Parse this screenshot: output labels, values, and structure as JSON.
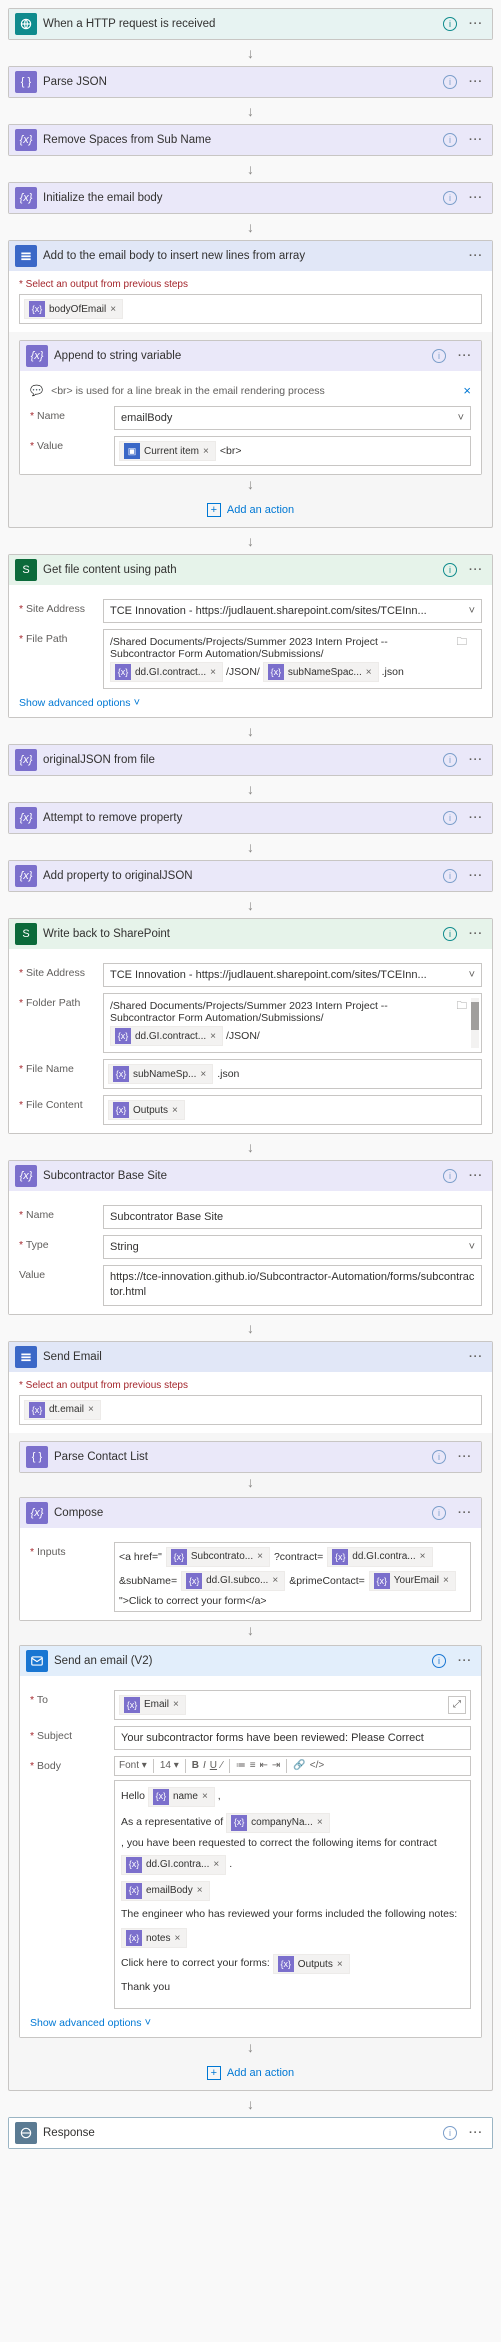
{
  "steps": {
    "trigger": {
      "title": "When a HTTP request is received"
    },
    "parseJson": {
      "title": "Parse JSON"
    },
    "removeSpaces": {
      "title": "Remove Spaces from Sub Name"
    },
    "initBody": {
      "title": "Initialize the email body"
    },
    "loop": {
      "title": "Add to the email body to insert new lines from array",
      "selectHint": "* Select an output from previous steps",
      "outputToken": "bodyOfEmail",
      "append": {
        "title": "Append to string variable",
        "note": "<br> is used for a line break in the email rendering process",
        "nameLabel": "Name",
        "nameValue": "emailBody",
        "valueLabel": "Value",
        "valueToken": "Current item",
        "valueSuffix": "<br>"
      },
      "addAction": "Add an action"
    },
    "getFile": {
      "title": "Get file content using path",
      "siteLabel": "Site Address",
      "siteValue": "TCE Innovation - https://judlauent.sharepoint.com/sites/TCEInn...",
      "pathLabel": "File Path",
      "pathPrefix1": "/Shared Documents/Projects/Summer 2023 Intern Project -- ",
      "pathPrefix2": "Subcontractor Form Automation/Submissions/",
      "token1": "dd.GI.contract...",
      "mid1": "/JSON/",
      "token2": "subNameSpac...",
      "suffix": ".json",
      "advanced": "Show advanced options"
    },
    "origJson": {
      "title": "originalJSON from file"
    },
    "removeProp": {
      "title": "Attempt to remove property"
    },
    "addProp": {
      "title": "Add property to originalJSON"
    },
    "writeBack": {
      "title": "Write back to SharePoint",
      "siteLabel": "Site Address",
      "siteValue": "TCE Innovation - https://judlauent.sharepoint.com/sites/TCEInn...",
      "folderLabel": "Folder Path",
      "folderPrefix1": "/Shared Documents/Projects/Summer 2023 Intern Project -- ",
      "folderPrefix2": "Subcontractor Form Automation/Submissions/",
      "folderToken": "dd.GI.contract...",
      "folderSuffix": "/JSON/",
      "fileNameLabel": "File Name",
      "fileNameToken": "subNameSp...",
      "fileNameSuffix": ".json",
      "fileContentLabel": "File Content",
      "fileContentToken": "Outputs"
    },
    "baseSite": {
      "title": "Subcontractor Base Site",
      "nameLabel": "Name",
      "nameValue": "Subcontrator Base Site",
      "typeLabel": "Type",
      "typeValue": "String",
      "valueLabel": "Value",
      "valueValue": "https://tce-innovation.github.io/Subcontractor-Automation/forms/subcontractor.html"
    },
    "sendEmailOuter": {
      "title": "Send Email",
      "selectHint": "* Select an output from previous steps",
      "outputToken": "dt.email",
      "parseContact": {
        "title": "Parse Contact List"
      },
      "compose": {
        "title": "Compose",
        "inputsLabel": "Inputs",
        "t1": "<a href=\"",
        "token1": "Subcontrato...",
        "t2": "?contract=",
        "token2": "dd.GI.contra...",
        "t3": "&subName=",
        "token3": "dd.GI.subco...",
        "t4": "&primeContact=",
        "token4": "YourEmail",
        "t5": "\">Click to correct your form</a>"
      },
      "email": {
        "title": "Send an email (V2)",
        "toLabel": "To",
        "toToken": "Email",
        "subjectLabel": "Subject",
        "subjectValue": "Your subcontractor forms have been reviewed: Please Correct",
        "bodyLabel": "Body",
        "fontLabel": "Font",
        "sizeValue": "14",
        "l1a": "Hello",
        "l1tok": "name",
        "l1b": ",",
        "l2a": "As a representative of",
        "l2tok1": "companyNa...",
        "l2b": ", you have been requested to correct the following items for contract",
        "l2tok2": "dd.GI.contra...",
        "l2c": ".",
        "l3tok": "emailBody",
        "l4": "The engineer who has reviewed your forms included the following notes:",
        "l5tok": "notes",
        "l6a": "Click here to correct your forms:",
        "l6tok": "Outputs",
        "l7": "Thank you"
      },
      "advanced": "Show advanced options",
      "addAction": "Add an action"
    },
    "response": {
      "title": "Response"
    }
  }
}
